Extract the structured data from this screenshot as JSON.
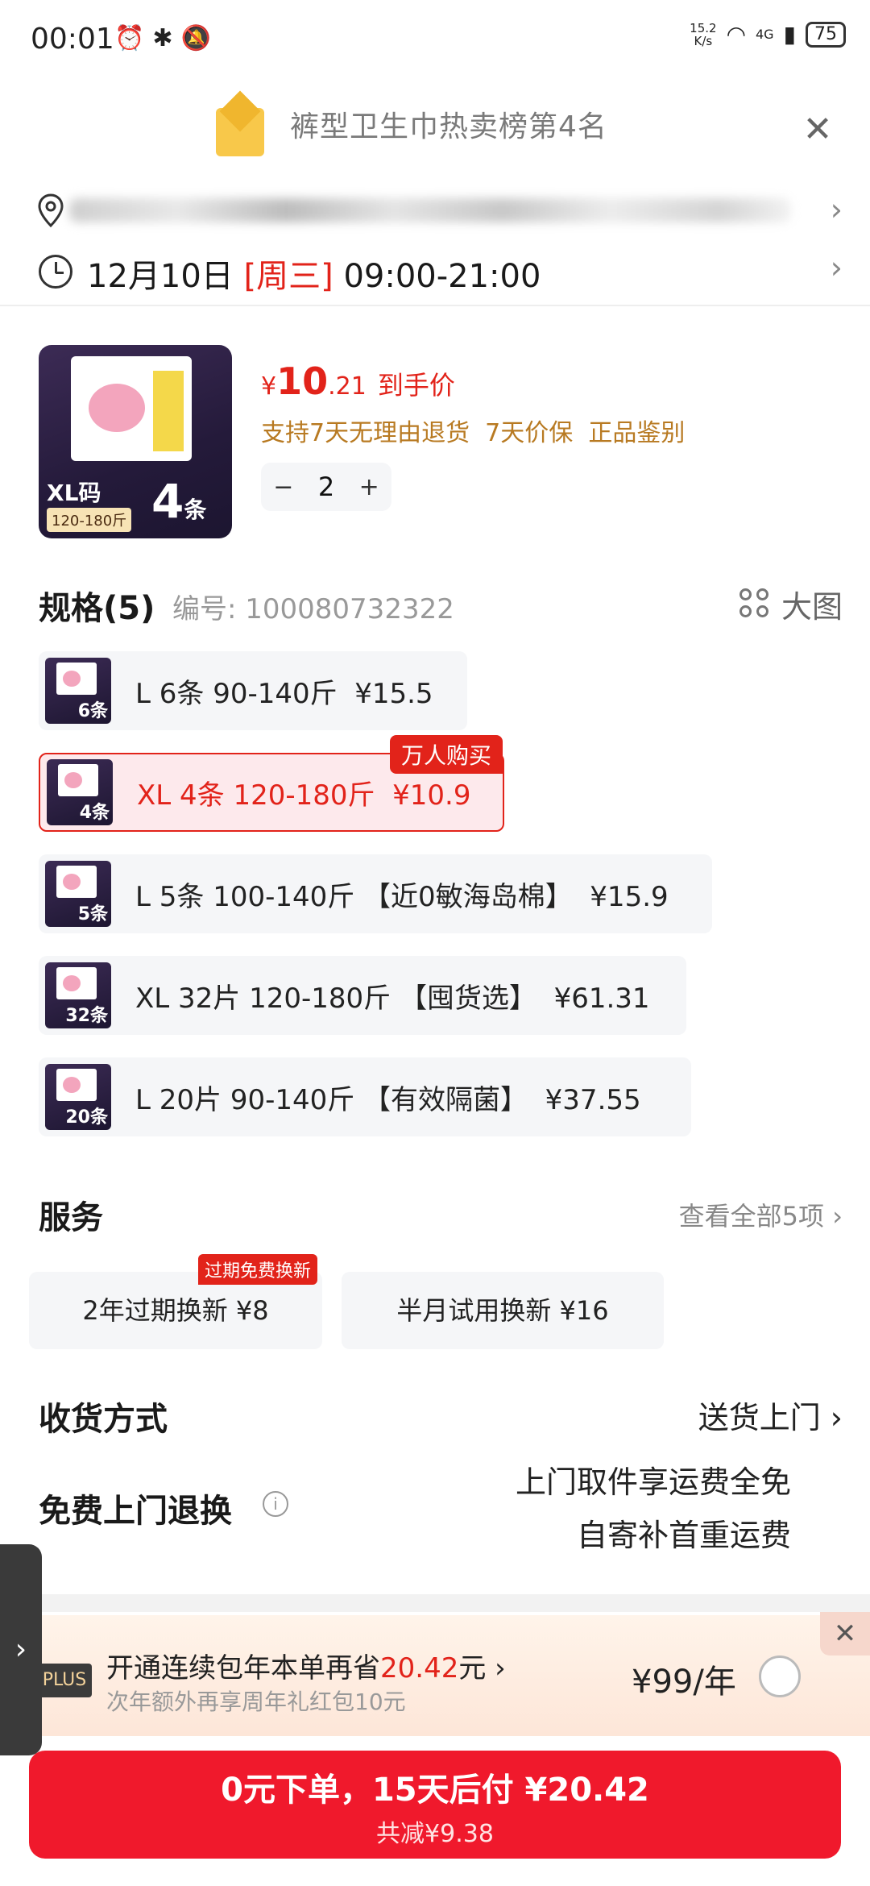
{
  "status_bar": {
    "time": "00:01",
    "net_speed_value": "15.2",
    "net_speed_unit": "K/s",
    "network": "4G",
    "battery": "75"
  },
  "banner": {
    "title": "裤型卫生巾热卖榜第4名"
  },
  "delivery": {
    "date": "12月10日",
    "weekday": "[周三]",
    "hours": "09:00-21:00"
  },
  "product": {
    "thumb_size": "XL码",
    "thumb_range": "120-180斤",
    "thumb_count": "4",
    "thumb_count_unit": "条",
    "price_symbol": "¥",
    "price_int": "10",
    "price_dec": ".21",
    "price_label": "到手价",
    "guarantee": "支持7天无理由退货  7天价保  正品鉴别",
    "qty_minus": "−",
    "quantity": "2",
    "qty_plus": "+"
  },
  "spec": {
    "title": "规格(5)",
    "code": "编号: 100080732322",
    "big_pic": "大图",
    "badge": "万人购买",
    "options": [
      {
        "label": "L 6条 90-140斤  ¥15.5",
        "thumb": "6条"
      },
      {
        "label": "XL 4条 120-180斤  ¥10.9",
        "thumb": "4条"
      },
      {
        "label": "L 5条 100-140斤 【近0敏海岛棉】  ¥15.9",
        "thumb": "5条"
      },
      {
        "label": "XL 32片 120-180斤 【囤货选】  ¥61.31",
        "thumb": "32条"
      },
      {
        "label": "L 20片 90-140斤 【有效隔菌】  ¥37.55",
        "thumb": "20条"
      }
    ]
  },
  "service": {
    "title": "服务",
    "view_all": "查看全部5项 ›",
    "badge": "过期免费换新",
    "options": [
      "2年过期换新  ¥8",
      "半月试用换新  ¥16"
    ]
  },
  "shipping": {
    "title": "收货方式",
    "value": "送货上门 ›"
  },
  "returns": {
    "title": "免费上门退换",
    "line1": "上门取件享运费全免",
    "line2": "自寄补首重运费"
  },
  "plus": {
    "logo": "PLUS",
    "main_prefix": "开通连续包年本单再省",
    "main_amount": "20.42",
    "main_suffix": "元 ›",
    "sub": "次年额外再享周年礼红包10元",
    "price": "¥99/年",
    "close": "✕"
  },
  "order": {
    "main": "0元下单，15天后付 ¥20.42",
    "sub": "共减¥9.38"
  }
}
